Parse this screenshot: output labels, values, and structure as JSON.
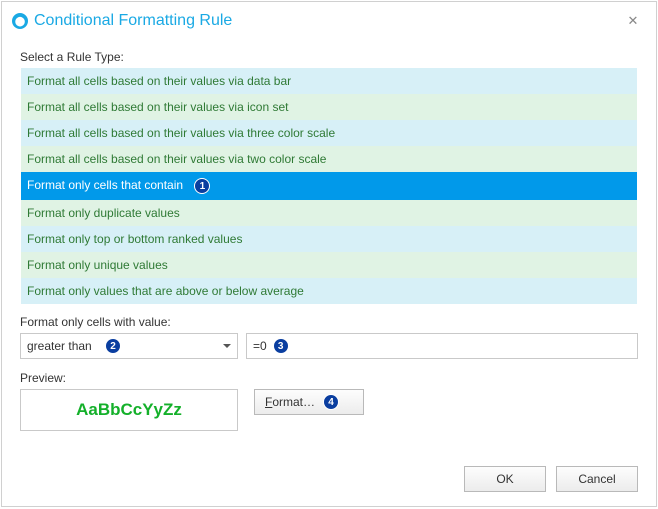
{
  "window": {
    "title": "Conditional Formatting Rule",
    "close_glyph": "✕"
  },
  "labels": {
    "select_rule_type": "Select a Rule Type:",
    "format_only_with_value": "Format only cells with value:",
    "preview": "Preview:"
  },
  "rule_types": [
    {
      "label": "Format all cells based on their values via data bar",
      "selected": false,
      "altClass": "alt-a"
    },
    {
      "label": "Format all cells based on their values via icon set",
      "selected": false,
      "altClass": "alt-b"
    },
    {
      "label": "Format all cells based on their values via three color scale",
      "selected": false,
      "altClass": "alt-a"
    },
    {
      "label": "Format all cells based on their values via two color scale",
      "selected": false,
      "altClass": "alt-b"
    },
    {
      "label": "Format only cells that contain",
      "selected": true,
      "altClass": "alt-a",
      "badge": "1"
    },
    {
      "label": "Format only duplicate values",
      "selected": false,
      "altClass": "alt-b"
    },
    {
      "label": "Format only top or bottom ranked values",
      "selected": false,
      "altClass": "alt-a"
    },
    {
      "label": "Format only unique values",
      "selected": false,
      "altClass": "alt-b"
    },
    {
      "label": "Format only values that are above or below average",
      "selected": false,
      "altClass": "alt-a"
    }
  ],
  "condition": {
    "operator": "greater than",
    "operator_badge": "2",
    "value": "=0",
    "value_badge": "3"
  },
  "preview_sample": "AaBbCcYyZz",
  "format_button": {
    "prefix": "F",
    "rest": "ormat…",
    "badge": "4"
  },
  "footer": {
    "ok": "OK",
    "cancel": "Cancel"
  }
}
